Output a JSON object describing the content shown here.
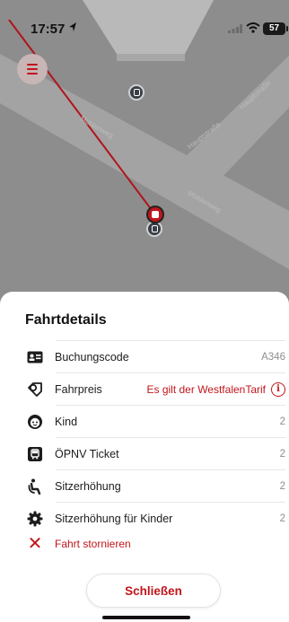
{
  "status_bar": {
    "time": "17:57",
    "battery": "57"
  },
  "map": {
    "streets": [
      {
        "name": "Hauptstraße"
      },
      {
        "name": "Hauptstraße"
      },
      {
        "name": "Mühlenweg"
      },
      {
        "name": "Mühlenweg"
      }
    ]
  },
  "sheet": {
    "title": "Fahrtdetails",
    "rows": [
      {
        "label": "Buchungscode",
        "value": "A346",
        "icon": "booking-card-icon"
      },
      {
        "label": "Fahrpreis",
        "value": "Es gilt der WestfalenTarif",
        "icon": "price-tag-icon"
      },
      {
        "label": "Kind",
        "value": "2",
        "icon": "child-face-icon"
      },
      {
        "label": "ÖPNV Ticket",
        "value": "2",
        "icon": "bus-ticket-icon"
      },
      {
        "label": "Sitzerhöhung",
        "value": "2",
        "icon": "child-seat-icon"
      },
      {
        "label": "Sitzerhöhung für Kinder",
        "value": "2",
        "icon": "gear-icon"
      }
    ],
    "cancel_label": "Fahrt stornieren",
    "close_label": "Schließen"
  },
  "colors": {
    "accent": "#c0161c",
    "map_bg": "#8d8d8d",
    "road": "#a3a3a3",
    "building": "#b9b9b9"
  }
}
